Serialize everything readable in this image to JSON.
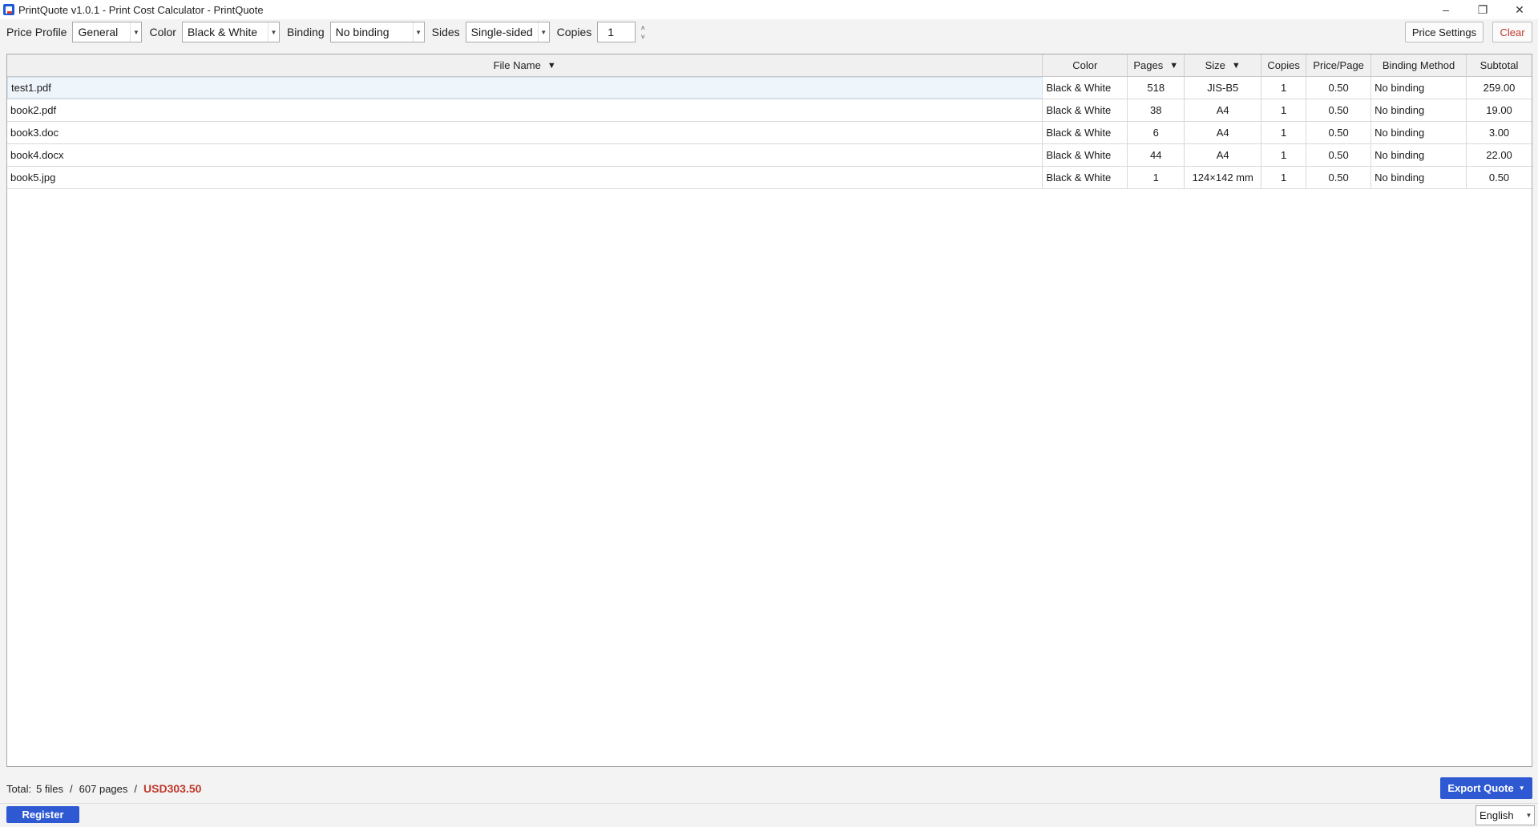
{
  "window": {
    "title": "PrintQuote v1.0.1 - Print Cost Calculator - PrintQuote",
    "minimize": "–",
    "restore": "❐",
    "close": "✕"
  },
  "toolbar": {
    "price_profile_label": "Price Profile",
    "price_profile_value": "General",
    "color_label": "Color",
    "color_value": "Black & White",
    "binding_label": "Binding",
    "binding_value": "No binding",
    "sides_label": "Sides",
    "sides_value": "Single-sided",
    "copies_label": "Copies",
    "copies_value": "1",
    "price_settings_label": "Price Settings",
    "clear_label": "Clear"
  },
  "table": {
    "headers": {
      "file_name": "File Name",
      "color": "Color",
      "pages": "Pages",
      "size": "Size",
      "copies": "Copies",
      "price_page": "Price/Page",
      "binding_method": "Binding Method",
      "subtotal": "Subtotal"
    },
    "sort_glyph": "▼",
    "rows": [
      {
        "file": "test1.pdf",
        "color": "Black & White",
        "pages": "518",
        "size": "JIS-B5",
        "copies": "1",
        "price": "0.50",
        "binding": "No binding",
        "subtotal": "259.00"
      },
      {
        "file": "book2.pdf",
        "color": "Black & White",
        "pages": "38",
        "size": "A4",
        "copies": "1",
        "price": "0.50",
        "binding": "No binding",
        "subtotal": "19.00"
      },
      {
        "file": "book3.doc",
        "color": "Black & White",
        "pages": "6",
        "size": "A4",
        "copies": "1",
        "price": "0.50",
        "binding": "No binding",
        "subtotal": "3.00"
      },
      {
        "file": "book4.docx",
        "color": "Black & White",
        "pages": "44",
        "size": "A4",
        "copies": "1",
        "price": "0.50",
        "binding": "No binding",
        "subtotal": "22.00"
      },
      {
        "file": "book5.jpg",
        "color": "Black & White",
        "pages": "1",
        "size": "124×142 mm",
        "copies": "1",
        "price": "0.50",
        "binding": "No binding",
        "subtotal": "0.50"
      }
    ]
  },
  "footer": {
    "total_label": "Total:",
    "files": "5 files",
    "sep": "/",
    "pages": "607 pages",
    "amount": "USD303.50",
    "export_label": "Export Quote",
    "export_caret": "▼",
    "register_label": "Register",
    "language": "English"
  },
  "colors": {
    "accent": "#2f59d3",
    "danger": "#c0392b",
    "selected_row": "#eef5fb"
  }
}
